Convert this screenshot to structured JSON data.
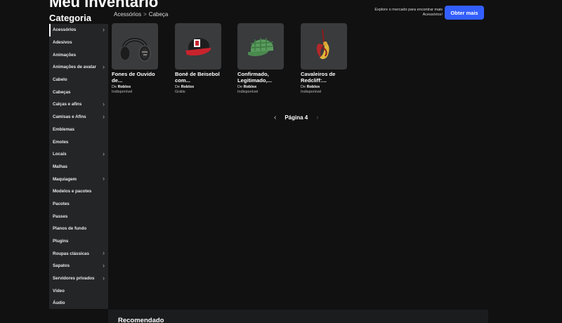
{
  "page": {
    "title": "Meu inventário"
  },
  "sidebar": {
    "title": "Categoria",
    "items": [
      {
        "label": "Acessórios",
        "chevron": true,
        "active": true
      },
      {
        "label": "Adesivos",
        "chevron": false
      },
      {
        "label": "Animações",
        "chevron": false
      },
      {
        "label": "Animações de avatar",
        "chevron": true
      },
      {
        "label": "Cabelo",
        "chevron": false
      },
      {
        "label": "Cabeças",
        "chevron": false
      },
      {
        "label": "Calças e afins",
        "chevron": true
      },
      {
        "label": "Camisas e Afins",
        "chevron": true
      },
      {
        "label": "Emblemas",
        "chevron": false
      },
      {
        "label": "Emotes",
        "chevron": false
      },
      {
        "label": "Locais",
        "chevron": true
      },
      {
        "label": "Malhas",
        "chevron": false
      },
      {
        "label": "Maquiagem",
        "chevron": true
      },
      {
        "label": "Modelos e pacotes",
        "chevron": false
      },
      {
        "label": "Pacotes",
        "chevron": false
      },
      {
        "label": "Passes",
        "chevron": false
      },
      {
        "label": "Planos de fundo",
        "chevron": false
      },
      {
        "label": "Plugins",
        "chevron": false
      },
      {
        "label": "Roupas clássicas",
        "chevron": true
      },
      {
        "label": "Sapatos",
        "chevron": true
      },
      {
        "label": "Servidores privados",
        "chevron": true
      },
      {
        "label": "Vídeo",
        "chevron": false
      },
      {
        "label": "Áudio",
        "chevron": false
      }
    ]
  },
  "breadcrumb": {
    "parent": "Acessórios",
    "separator": ">",
    "current": "Cabeça"
  },
  "promo": {
    "text": "Explore o mercado para encontrar mais Acessórios!",
    "button": "Obter mais"
  },
  "items": [
    {
      "name": "Fones de Ouvido de...",
      "creator_prefix": "De",
      "creator": "Roblox",
      "price": "Indisponível",
      "icon": "headphones-icon"
    },
    {
      "name": "Boné de Beisebol com...",
      "creator_prefix": "De",
      "creator": "Roblox",
      "price": "Grátis",
      "icon": "baseball-cap-icon"
    },
    {
      "name": "Confirmado, Legitimado,...",
      "creator_prefix": "De",
      "creator": "Roblox",
      "price": "Indisponível",
      "icon": "plaid-cap-icon"
    },
    {
      "name": "Cavaleiros de Redcliff:...",
      "creator_prefix": "De",
      "creator": "Roblox",
      "price": "Indisponível",
      "icon": "knight-plume-icon"
    }
  ],
  "pagination": {
    "label": "Página 4",
    "prev": "‹",
    "next": "›"
  },
  "recommended": {
    "title": "Recomendado"
  },
  "colors": {
    "accent": "#335fff",
    "sidebar": "#232527",
    "background": "#111112",
    "card": "#393b3d"
  }
}
